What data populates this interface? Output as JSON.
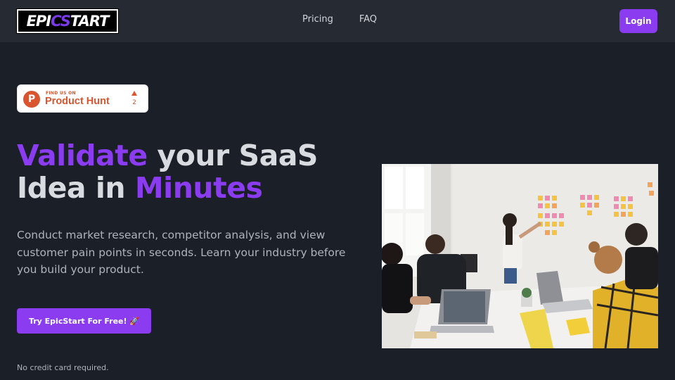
{
  "brand": {
    "logo_prefix": "EPI",
    "logo_accent": "CS",
    "logo_suffix": "TART"
  },
  "nav": {
    "links": [
      "Pricing",
      "FAQ"
    ],
    "login_label": "Login"
  },
  "product_hunt": {
    "icon_letter": "P",
    "small_text": "FIND US ON",
    "big_text": "Product Hunt",
    "upvote_count": "2"
  },
  "hero": {
    "headline_part1": "Validate",
    "headline_part2": " your SaaS",
    "headline_part3": "Idea in ",
    "headline_part4": "Minutes",
    "subtext": "Conduct market research, competitor analysis, and view customer pain points in seconds. Learn your industry before you build your product.",
    "cta_label": "Try EpicStart For Free! 🚀",
    "note": "No credit card required."
  },
  "colors": {
    "background": "#1b1f27",
    "navbar": "#262a33",
    "accent": "#8b3cf0",
    "product_hunt": "#da552f"
  }
}
